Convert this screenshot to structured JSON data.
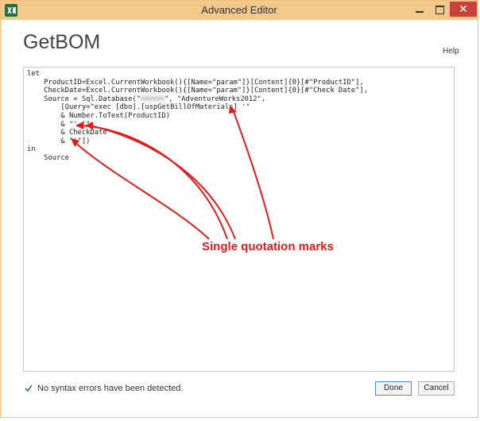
{
  "window": {
    "title": "Advanced Editor",
    "close_glyph": "✕"
  },
  "header": {
    "query_name": "GetBOM",
    "help_label": "Help"
  },
  "editor": {
    "lines": [
      "let",
      "    ProductID=Excel.CurrentWorkbook(){[Name=\"param\"]}[Content]{0}[#\"ProductID\"],",
      "    CheckDate=Excel.CurrentWorkbook(){[Name=\"param\"]}[Content]{0}[#\"Check Date\"],",
      "    Source = Sql.Database(\"",
      "        [Query=\"exec [dbo].[uspGetBillOfMaterials] '\"",
      "        & Number.ToText(ProductID)",
      "        & \"','\"",
      "        & CheckDate",
      "        & \"'\"])",
      "in",
      "    Source"
    ],
    "line3_tail": "\", \"AdventureWorks2012\","
  },
  "annotation": {
    "text": "Single quotation marks",
    "color": "#e41c1c"
  },
  "status": {
    "message": "No syntax errors have been detected.",
    "icon": "check-icon"
  },
  "buttons": {
    "done": "Done",
    "cancel": "Cancel"
  },
  "colors": {
    "titlebar": "#f2c98a",
    "close": "#c7423a",
    "accent": "#1e7145"
  }
}
